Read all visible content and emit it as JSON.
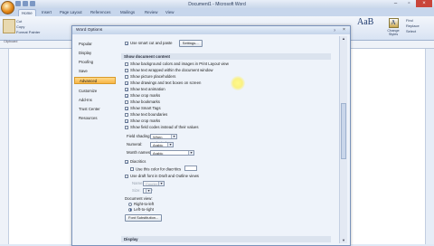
{
  "window": {
    "title": "Document1 - Microsoft Word",
    "tabs": [
      "Home",
      "Insert",
      "Page Layout",
      "References",
      "Mailings",
      "Review",
      "View"
    ],
    "ribbon": {
      "paste_small": [
        "Cut",
        "Copy",
        "Format Painter"
      ],
      "clipboard_label": "Clipboard",
      "styles_glyph": "AaB",
      "change_styles": "Change Styles",
      "change_styles_glyph": "A",
      "editing": [
        "Find",
        "Replace",
        "Select"
      ]
    },
    "controls": {
      "min": "–",
      "max": "▫",
      "close": "×"
    }
  },
  "dialog": {
    "title": "Word Options",
    "help": "?",
    "close": "×",
    "nav": [
      "Popular",
      "Display",
      "Proofing",
      "Save",
      "Advanced",
      "Customize",
      "Add-Ins",
      "Trust Center",
      "Resources"
    ],
    "active_nav": "Advanced",
    "top_row": {
      "label": "Use smart cut and paste",
      "button": "Settings..."
    },
    "section_show_doc": "Show document content",
    "checks": [
      {
        "label": "Show background colors and images in Print Layout view",
        "checked": false
      },
      {
        "label": "Show text wrapped within the document window",
        "checked": false
      },
      {
        "label": "Show picture placeholders",
        "checked": false
      },
      {
        "label": "Show drawings and text boxes on screen",
        "checked": true
      },
      {
        "label": "Show text animation",
        "checked": true
      },
      {
        "label": "Show crop marks",
        "checked": true
      },
      {
        "label": "Show bookmarks",
        "checked": false
      },
      {
        "label": "Show Smart Tags",
        "checked": true
      },
      {
        "label": "Show text boundaries",
        "checked": false
      },
      {
        "label": "Show crop marks",
        "checked": true
      },
      {
        "label": "Show field codes instead of their values",
        "checked": false
      }
    ],
    "field_shading": {
      "label": "Field shading:",
      "value": "When selected"
    },
    "numeral": {
      "label": "Numeral:",
      "value": "Arabic"
    },
    "month_names": {
      "label": "Month names:",
      "value": "Arabic"
    },
    "diacritics": {
      "label": "Diacritics",
      "checked": true
    },
    "diacritics_color": {
      "label": "Use this color for diacritics"
    },
    "draft_font": {
      "label": "Use draft font in Draft and Outline views",
      "checked": false
    },
    "draft_name": {
      "label": "Name:",
      "value": "Courier New"
    },
    "draft_size": {
      "label": "Size:",
      "value": "10"
    },
    "doc_view": {
      "label": "Document view:",
      "options": [
        {
          "label": "Right-to-left",
          "selected": false
        },
        {
          "label": "Left-to-right",
          "selected": true
        }
      ]
    },
    "font_sub_button": "Font Substitution...",
    "section_display": "Display",
    "scroll_up": "▲",
    "scroll_down": "▼",
    "check_glyph": "✓",
    "arrow_glyph": "▼"
  }
}
